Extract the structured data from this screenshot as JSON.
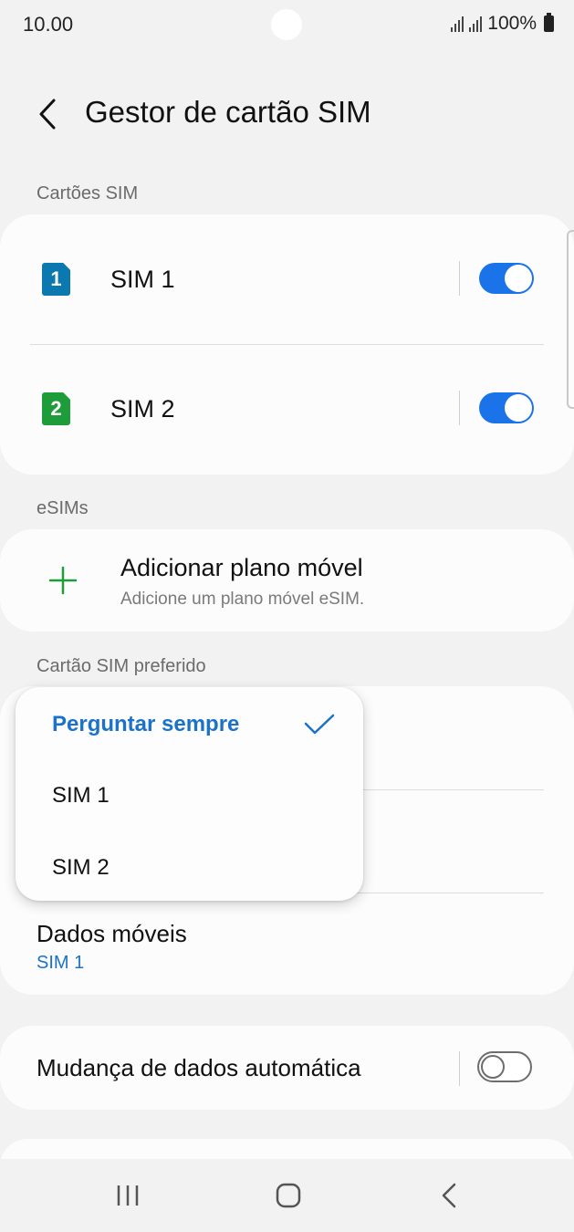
{
  "status_bar": {
    "time": "10.00",
    "battery": "100%"
  },
  "header": {
    "title": "Gestor de cartão SIM"
  },
  "sections": {
    "sim_cards": "Cartões SIM",
    "esims": "eSIMs",
    "preferred": "Cartão SIM preferido"
  },
  "sim_cards": [
    {
      "badge": "1",
      "label": "SIM 1",
      "enabled": true,
      "color": "#0b78b0"
    },
    {
      "badge": "2",
      "label": "SIM 2",
      "enabled": true,
      "color": "#1e9c3a"
    }
  ],
  "esim": {
    "title": "Adicionar plano móvel",
    "subtitle": "Adicione um plano móvel eSIM."
  },
  "preferred": {
    "mobile_data_label": "Dados móveis",
    "mobile_data_value": "SIM 1"
  },
  "auto_switch": {
    "label": "Mudança de dados automática",
    "enabled": false
  },
  "popup": {
    "options": [
      "Perguntar sempre",
      "SIM 1",
      "SIM 2"
    ],
    "selected_index": 0
  },
  "colors": {
    "accent": "#1a73e8",
    "selected_text": "#1a73c8",
    "add_icon": "#1e9c3a"
  }
}
